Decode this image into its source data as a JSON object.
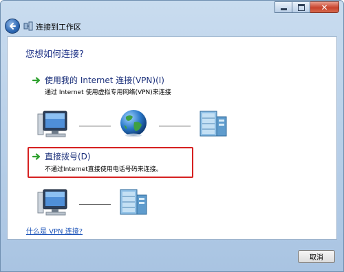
{
  "window": {
    "title": "连接到工作区",
    "controls": {
      "minimize": "minimize-icon",
      "maximize": "maximize-icon",
      "close": "close-icon"
    }
  },
  "main": {
    "heading": "您想如何连接?",
    "options": [
      {
        "title": "使用我的 Internet 连接(VPN)(I)",
        "description": "通过 Internet 使用虚拟专用网络(VPN)来连接",
        "icon": "green-arrow-icon"
      },
      {
        "title": "直接拨号(D)",
        "description": "不通过Internet直接使用电话号码来连接。",
        "icon": "green-arrow-icon",
        "highlighted": true,
        "highlight_color": "#d62020"
      }
    ],
    "diagrams": {
      "vpn": [
        "computer-icon",
        "globe-icon",
        "server-icon"
      ],
      "dial": [
        "computer-icon",
        "server-icon"
      ]
    },
    "help_link": "什么是 VPN 连接?"
  },
  "footer": {
    "cancel_label": "取消"
  },
  "colors": {
    "heading": "#1e3287",
    "link": "#1a52b8",
    "frame": "#a9c4e2",
    "arrow": "#2fa12f"
  }
}
